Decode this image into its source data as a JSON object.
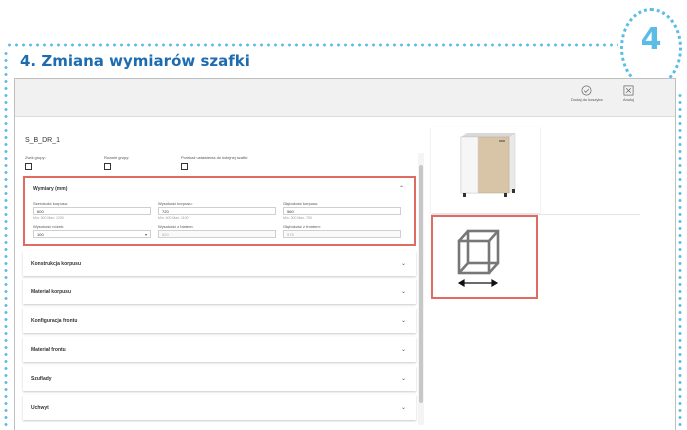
{
  "badge": {
    "number": "4"
  },
  "section_title": "4. Zmiana wymiarów szafki",
  "toolbar": {
    "add_to_cart_label": "Dodaj do koszyka",
    "back_label": "Anuluj"
  },
  "cabinet_name": "S_B_DR_1",
  "checkboxes": [
    {
      "label": "Zwól grupy:"
    },
    {
      "label": "Rozwiń grupy:"
    },
    {
      "label": "Przekaż ustawienia do kolejnej szafki:"
    }
  ],
  "dimensions": {
    "title": "Wymiary (mm)",
    "width": {
      "label": "Szerokość korpusu:",
      "value": "600",
      "hint": "Min: 300 Max: 1200"
    },
    "height": {
      "label": "Wysokość korpusu:",
      "value": "720",
      "hint": "Min: 400 Max: 1100"
    },
    "depth": {
      "label": "Głębokość korpusu:",
      "value": "560",
      "hint": "Min: 300 Max: 700"
    },
    "leg_height": {
      "label": "Wysokość nóżek:",
      "value": "100"
    },
    "height_with_top": {
      "label": "Wysokość z blatem:",
      "value": "820"
    },
    "depth_with_front": {
      "label": "Głębokość z frontem:",
      "value": "578"
    }
  },
  "panels": [
    {
      "title": "Konstrukcja korpusu"
    },
    {
      "title": "Materiał korpusu"
    },
    {
      "title": "Konfiguracja frontu"
    },
    {
      "title": "Materiał frontu"
    },
    {
      "title": "Szuflady"
    },
    {
      "title": "Uchwyt"
    }
  ],
  "icons": {
    "chevron_up": "chevron-up-icon",
    "chevron_down": "chevron-down-icon",
    "check": "check-circle-icon",
    "close": "close-icon"
  },
  "colors": {
    "accent_blue": "#1e6cb0",
    "dots": "#5bbde6",
    "highlight": "#e06b63",
    "cabinet_wood": "#d8c4a6"
  }
}
